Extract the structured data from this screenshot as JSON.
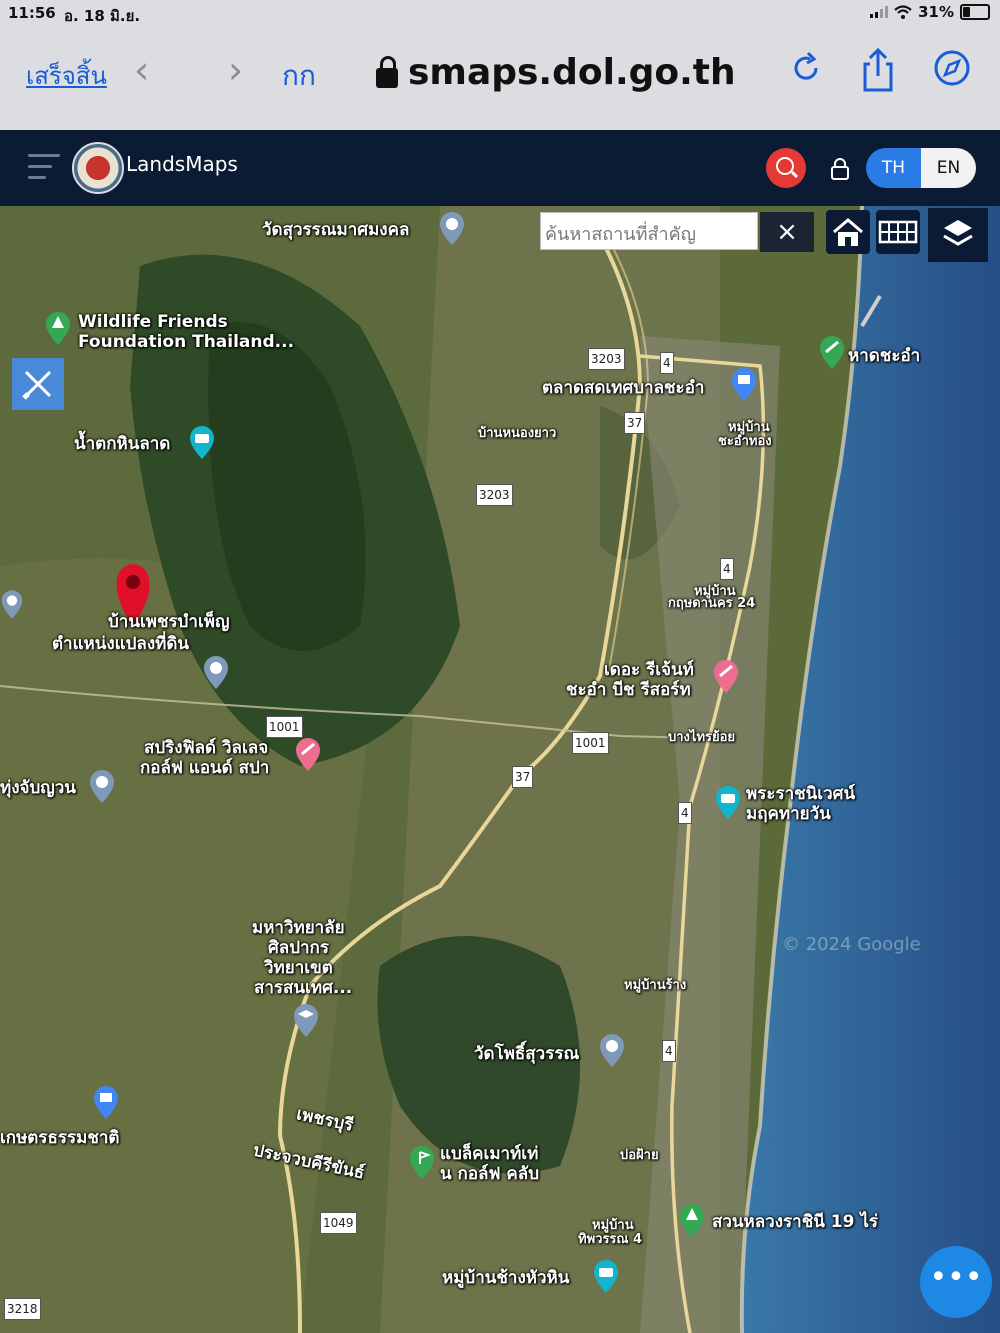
{
  "status": {
    "time": "11:56",
    "date": "อ. 18 มิ.ย.",
    "battery": "31%"
  },
  "browser": {
    "done": "เสร็จสิ้น",
    "text_size": "กก",
    "url": "smaps.dol.go.th"
  },
  "app": {
    "title": "LandsMaps",
    "lang_th": "TH",
    "lang_en": "EN"
  },
  "map": {
    "search_placeholder": "ค้นหาสถานที่สำคัญ",
    "clear": "×",
    "watermark": "© 2024 Google",
    "labels": {
      "wat_suwan": "วัดสุวรรณมาศมงคล",
      "wildlife_1": "Wildlife Friends",
      "wildlife_2": "Foundation Thailand...",
      "hat_chaam": "หาดชะอำ",
      "talat": "ตลาดสดเทศบาลชะอำ",
      "ban_nong": "บ้านหนองยาว",
      "nam_tok": "น้ำตกหินลาด",
      "mu_ban_chaam_1": "หมู่บ้าน",
      "mu_ban_chaam_2": "ชะอำทอง",
      "mu_ban_krit_1": "หมู่บ้าน",
      "mu_ban_krit_2": "กฤษดานคร 24",
      "ban_phet_1": "บ้านเพชรบำเพ็ญ",
      "ban_phet_2": "ตำแหน่งแปลงที่ดิน",
      "regent_1": "เดอะ รีเจ้นท์",
      "regent_2": "ชะอำ บีช รีสอร์ท",
      "springfield_1": "สปริงฟิลด์ วิลเลจ",
      "springfield_2": "กอล์ฟ แอนด์ สปา",
      "bang_sai": "บางไทรย้อย",
      "thung": "ทุ่งจับญวน",
      "phra_racha_1": "พระราชนิเวศน์",
      "phra_racha_2": "มฤคทายวัน",
      "silpakorn_1": "มหาวิทยาลัย",
      "silpakorn_2": "ศิลปากร",
      "silpakorn_3": "วิทยาเขต",
      "silpakorn_4": "สารสนเทศ...",
      "mu_ban_rang": "หมู่บ้านร้าง",
      "wat_pho": "วัดโพธิ์สุวรรณ",
      "kaset": "เกษตรธรรมชาติ",
      "phetchaburi": "เพชรบุรี",
      "prachuap": "ประจวบคีรีขันธ์",
      "black_mountain_1": "แบล็คเมาท์เท่",
      "black_mountain_2": "น กอล์ฟ คลับ",
      "bo_fai": "บ่อฝ้าย",
      "suan_luang": "สวนหลวงราชินี 19 ไร่",
      "mu_ban_thip_1": "หมู่บ้าน",
      "mu_ban_thip_2": "ทิพวรรณ 4",
      "mu_ban_chang": "หมู่บ้านช้างหัวหิน"
    },
    "roads": [
      "3203",
      "4",
      "37",
      "3203",
      "4",
      "1001",
      "1001",
      "37",
      "4",
      "4",
      "1049",
      "3218"
    ]
  },
  "colors": {
    "header": "#0b1b33",
    "accent": "#2a7be4",
    "pin": "#e0102a",
    "sea": "#2e5f94"
  }
}
